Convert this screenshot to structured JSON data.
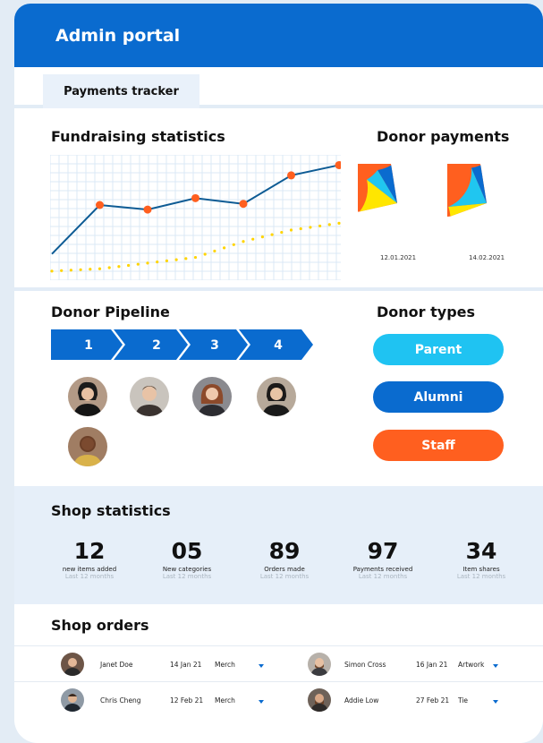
{
  "app": {
    "title": "Admin portal"
  },
  "tabs": [
    {
      "label": "Payments tracker"
    }
  ],
  "fundraising": {
    "title": "Fundraising statistics",
    "colors": {
      "line": "#0d5b94",
      "points": "#ff5f1f",
      "dotted": "#ffd400",
      "grid": "#dbe8f5"
    }
  },
  "donor_payments": {
    "title": "Donor payments",
    "pies": [
      {
        "date": "12.01.2021"
      },
      {
        "date": "14.02.2021"
      }
    ]
  },
  "chart_data": [
    {
      "type": "line",
      "title": "Fundraising statistics",
      "series": [
        {
          "values": [
            3,
            46,
            42,
            52,
            47,
            72,
            81
          ]
        },
        {
          "values": [
            -12,
            -10,
            -5,
            0,
            14,
            24,
            30
          ]
        }
      ],
      "ylim": [
        -20,
        90
      ],
      "grid": true
    },
    {
      "type": "pie",
      "label": "12.01.2021",
      "values": [
        74,
        14,
        6,
        6
      ],
      "colors": [
        "#ff5f1f",
        "#ffe600",
        "#20c6f0",
        "#0a6bcf"
      ]
    },
    {
      "type": "pie",
      "label": "14.02.2021",
      "values": [
        72,
        4,
        20,
        4
      ],
      "colors": [
        "#ff5f1f",
        "#ffe600",
        "#20c6f0",
        "#0a6bcf"
      ]
    }
  ],
  "pipeline": {
    "title": "Donor Pipeline",
    "steps": [
      "1",
      "2",
      "3",
      "4"
    ],
    "color": "#0a6bcf"
  },
  "donor_types": {
    "title": "Donor types",
    "items": [
      {
        "label": "Parent",
        "color": "#1fc3f2"
      },
      {
        "label": "Alumni",
        "color": "#0a6bcf"
      },
      {
        "label": "Staff",
        "color": "#ff5f1f"
      }
    ]
  },
  "shop_stats": {
    "title": "Shop statistics",
    "items": [
      {
        "value": "12",
        "label": "new items added",
        "sub": "Last 12 months"
      },
      {
        "value": "05",
        "label": "New categories",
        "sub": "Last 12 months"
      },
      {
        "value": "89",
        "label": "Orders made",
        "sub": "Last 12 months"
      },
      {
        "value": "97",
        "label": "Payments received",
        "sub": "Last 12 months"
      },
      {
        "value": "34",
        "label": "Item shares",
        "sub": "Last 12 months"
      }
    ]
  },
  "shop_orders": {
    "title": "Shop orders",
    "rows": [
      [
        {
          "name": "Janet Doe",
          "date": "14 Jan 21",
          "category": "Merch"
        },
        {
          "name": "Simon Cross",
          "date": "16 Jan 21",
          "category": "Artwork"
        }
      ],
      [
        {
          "name": "Chris Cheng",
          "date": "12 Feb 21",
          "category": "Merch"
        },
        {
          "name": "Addie Low",
          "date": "27 Feb 21",
          "category": "Tie"
        }
      ]
    ]
  }
}
